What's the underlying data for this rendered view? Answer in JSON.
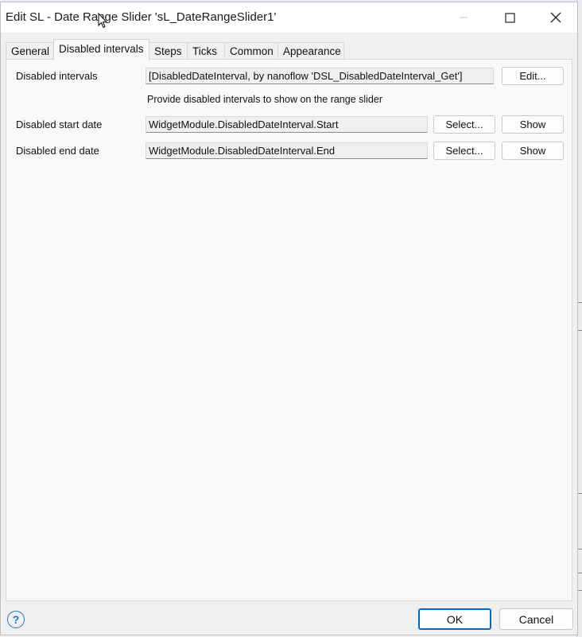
{
  "window": {
    "title": "Edit SL - Date Range Slider 'sL_DateRangeSlider1'"
  },
  "tabs": [
    {
      "label": "General"
    },
    {
      "label": "Disabled intervals"
    },
    {
      "label": "Steps"
    },
    {
      "label": "Ticks"
    },
    {
      "label": "Common"
    },
    {
      "label": "Appearance"
    }
  ],
  "active_tab": "Disabled intervals",
  "form": {
    "disabled_intervals": {
      "label": "Disabled intervals",
      "value": "[DisabledDateInterval, by nanoflow 'DSL_DisabledDateInterval_Get']",
      "edit_label": "Edit...",
      "hint": "Provide disabled intervals to show on the range slider"
    },
    "start_date": {
      "label": "Disabled start date",
      "value": "WidgetModule.DisabledDateInterval.Start",
      "select_label": "Select...",
      "show_label": "Show"
    },
    "end_date": {
      "label": "Disabled end date",
      "value": "WidgetModule.DisabledDateInterval.End",
      "select_label": "Select...",
      "show_label": "Show"
    }
  },
  "footer": {
    "ok_label": "OK",
    "cancel_label": "Cancel",
    "help_glyph": "?"
  },
  "icons": {
    "minimize": "minimize-icon",
    "maximize": "maximize-icon",
    "close": "close-icon",
    "help": "help-icon"
  }
}
